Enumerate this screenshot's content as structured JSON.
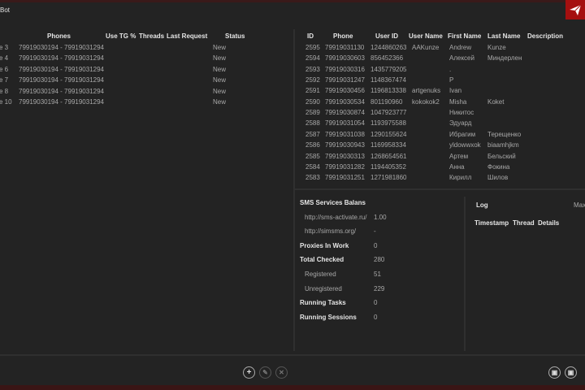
{
  "app": {
    "title": "Bot",
    "logo_icon": "paper-plane-icon",
    "accent": "#a50f0f"
  },
  "tasks": {
    "columns": [
      "Phones",
      "Use TG %",
      "Threads",
      "Last Request",
      "Status"
    ],
    "rows": [
      {
        "name": "e 3",
        "phones": "79919030194 - 79919031294",
        "status": "New"
      },
      {
        "name": "e 4",
        "phones": "79919030194 - 79919031294",
        "status": "New"
      },
      {
        "name": "e 6",
        "phones": "79919030194 - 79919031294",
        "status": "New"
      },
      {
        "name": "e 7",
        "phones": "79919030194 - 79919031294",
        "status": "New"
      },
      {
        "name": "e 8",
        "phones": "79919030194 - 79919031294",
        "status": "New"
      },
      {
        "name": "e 10",
        "phones": "79919030194 - 79919031294",
        "status": "New"
      }
    ]
  },
  "users": {
    "columns": [
      "ID",
      "Phone",
      "User ID",
      "User Name",
      "First Name",
      "Last Name",
      "Description"
    ],
    "rows": [
      [
        "2595",
        "79919031130",
        "1244860263",
        "AAKunze",
        "Andrew",
        "Kunze"
      ],
      [
        "2594",
        "79919030603",
        "856452366",
        "",
        "Алексей",
        "Миндерлен"
      ],
      [
        "2593",
        "79919030316",
        "1435779205",
        "",
        ".",
        ""
      ],
      [
        "2592",
        "79919031247",
        "1148367474",
        "",
        "P",
        ""
      ],
      [
        "2591",
        "79919030456",
        "1196813338",
        "artgenuks",
        "Ivan",
        ""
      ],
      [
        "2590",
        "79919030534",
        "801190960",
        "kokokok2",
        "Misha",
        "Koket"
      ],
      [
        "2589",
        "79919030874",
        "1047923777",
        "",
        "Никитос",
        ""
      ],
      [
        "2588",
        "79919031054",
        "1193975588",
        "",
        "Эдуард",
        ""
      ],
      [
        "2587",
        "79919031038",
        "1290155624",
        "",
        "Ибрагим",
        "Терещенко"
      ],
      [
        "2586",
        "79919030943",
        "1169958334",
        "",
        "yldowwxok",
        "biaamhjkm"
      ],
      [
        "2585",
        "79919030313",
        "1268654561",
        "",
        "Артем",
        "Бельский"
      ],
      [
        "2584",
        "79919031282",
        "1194405352",
        "",
        "Анна",
        "Фокина"
      ],
      [
        "2583",
        "79919031251",
        "1271981860",
        "",
        "Кирилл",
        "Шилов"
      ]
    ]
  },
  "stats": {
    "rows": [
      {
        "label": "SMS Services Balans",
        "value": "",
        "bold": true
      },
      {
        "label": "http://sms-activate.ru/",
        "value": "1.00",
        "bold": false
      },
      {
        "label": "http://simsms.org/",
        "value": "-",
        "bold": false
      },
      {
        "label": "Proxies In Work",
        "value": "0",
        "bold": true
      },
      {
        "label": "Total Checked",
        "value": "280",
        "bold": true
      },
      {
        "label": "Registered",
        "value": "51",
        "bold": false
      },
      {
        "label": "Unregistered",
        "value": "229",
        "bold": false
      },
      {
        "label": "Running Tasks",
        "value": "0",
        "bold": true
      },
      {
        "label": "Running Sessions",
        "value": "0",
        "bold": true
      }
    ]
  },
  "log": {
    "title": "Log",
    "max_label": "Max",
    "columns": [
      "Timestamp",
      "Thread",
      "Details"
    ]
  },
  "toolbar": {
    "add": "+",
    "edit": "✎",
    "delete": "✕",
    "export1": "▣",
    "export2": "▣"
  }
}
